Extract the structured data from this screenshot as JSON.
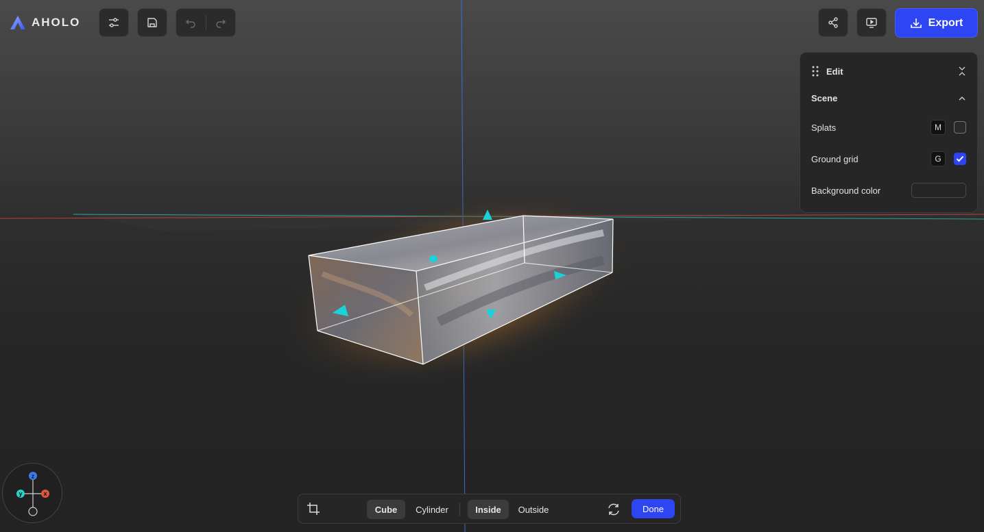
{
  "app": {
    "logo_text": "AHOLO"
  },
  "toolbar": {
    "settings_icon": "sliders-icon",
    "save_icon": "save-icon",
    "undo_icon": "undo-icon",
    "redo_icon": "redo-icon",
    "share_icon": "share-icon",
    "present_icon": "present-icon",
    "export_label": "Export",
    "export_icon": "download-icon"
  },
  "edit_panel": {
    "title": "Edit",
    "section_title": "Scene",
    "rows": [
      {
        "label": "Splats",
        "shortcut": "M",
        "checked": false
      },
      {
        "label": "Ground grid",
        "shortcut": "G",
        "checked": true
      }
    ],
    "background_label": "Background color",
    "background_color": "#262626"
  },
  "bottom_bar": {
    "crop_icon": "crop-icon",
    "shape_options": [
      "Cube",
      "Cylinder"
    ],
    "shape_selected": "Cube",
    "mode_options": [
      "Inside",
      "Outside"
    ],
    "mode_selected": "Inside",
    "reset_icon": "refresh-icon",
    "done_label": "Done"
  },
  "gizmo": {
    "z_label": "z",
    "y_label": "y",
    "x_label": "x"
  },
  "colors": {
    "accent": "#2d45f2",
    "handle": "#19d3d8",
    "axis_x": "#e0553f",
    "axis_y": "#2bd1c4",
    "axis_z": "#3b7de8"
  }
}
